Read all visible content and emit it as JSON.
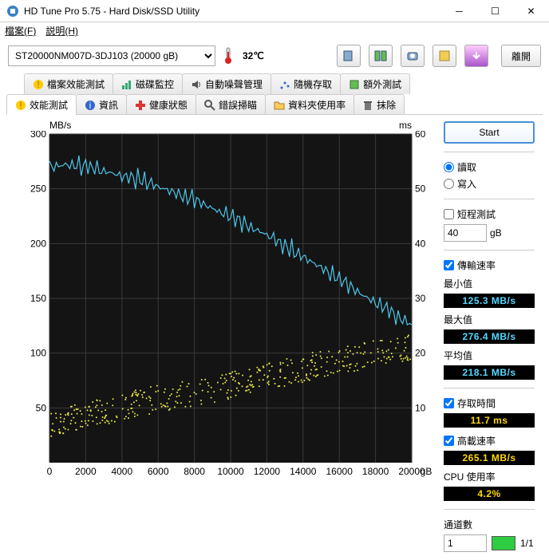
{
  "window": {
    "title": "HD Tune Pro 5.75 - Hard Disk/SSD Utility"
  },
  "menu": {
    "file": "檔案(F)",
    "help": "説明(H)"
  },
  "toolbar": {
    "drive_selected": "ST20000NM007D-3DJ103 (20000 gB)",
    "temp": "32℃",
    "exit": "離開"
  },
  "tabs_row1": {
    "file_bench": "檔案效能測試",
    "disk_mon": "磁碟監控",
    "aam": "自動噪聲管理",
    "random": "隨機存取",
    "extra": "額外測試"
  },
  "tabs_row2": {
    "bench": "效能測試",
    "info": "資訊",
    "health": "健康狀態",
    "error": "錯誤掃瞄",
    "folder": "資料夾使用率",
    "erase": "抹除"
  },
  "chart": {
    "y_left_label": "MB/s",
    "y_right_label": "ms",
    "x_unit": "gB"
  },
  "side": {
    "start": "Start",
    "read": "讀取",
    "write": "寫入",
    "short_test": "短程測試",
    "short_value": "40",
    "short_unit": "gB",
    "transfer_rate": "傳輸速率",
    "min_label": "最小值",
    "min_value": "125.3 MB/s",
    "max_label": "最大值",
    "max_value": "276.4 MB/s",
    "avg_label": "平均值",
    "avg_value": "218.1 MB/s",
    "access_time": "存取時間",
    "access_value": "11.7 ms",
    "burst_rate": "高載速率",
    "burst_value": "265.1 MB/s",
    "cpu_label": "CPU 使用率",
    "cpu_value": "4.2%",
    "pass_label": "通道數",
    "pass_value": "1",
    "pass_status": "1/1"
  },
  "chart_data": {
    "type": "line+scatter",
    "x_unit": "gB",
    "xlim": [
      0,
      20000
    ],
    "y_left_label": "MB/s",
    "y_left_lim": [
      0,
      300
    ],
    "y_right_label": "ms",
    "y_right_lim": [
      0,
      60
    ],
    "x_ticks": [
      0,
      2000,
      4000,
      6000,
      8000,
      10000,
      12000,
      14000,
      16000,
      18000,
      20000
    ],
    "y_left_ticks": [
      50,
      100,
      150,
      200,
      250,
      300
    ],
    "y_right_ticks": [
      10,
      20,
      30,
      40,
      50,
      60
    ],
    "series": [
      {
        "name": "Transfer Rate",
        "axis": "left",
        "type": "line",
        "color": "#4ec5e8",
        "x": [
          0,
          1000,
          2000,
          3000,
          4000,
          5000,
          6000,
          7000,
          8000,
          9000,
          10000,
          11000,
          12000,
          13000,
          14000,
          15000,
          16000,
          17000,
          18000,
          19000,
          20000
        ],
        "y": [
          270,
          272,
          270,
          266,
          262,
          258,
          252,
          246,
          240,
          232,
          224,
          216,
          208,
          198,
          188,
          178,
          168,
          156,
          146,
          136,
          126
        ]
      },
      {
        "name": "Access Time",
        "axis": "right",
        "type": "scatter",
        "color": "#e8e84a",
        "note": "cloud of points rising from ~5ms at 0gB to ~20ms near 18000gB; ~400 samples",
        "approx_trend_x": [
          0,
          5000,
          10000,
          15000,
          18000,
          20000
        ],
        "approx_trend_y": [
          6,
          10,
          13,
          17,
          19,
          20
        ],
        "spread_ms": 5
      }
    ]
  }
}
